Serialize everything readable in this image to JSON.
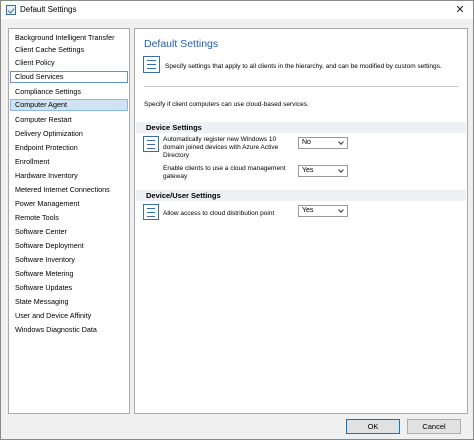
{
  "window": {
    "title": "Default Settings",
    "close_glyph": "✕"
  },
  "sidebar": {
    "items": [
      {
        "label": "Background Intelligent Transfer"
      },
      {
        "label": "Client Cache Settings"
      },
      {
        "label": "Client Policy"
      },
      {
        "label": "Cloud Services"
      },
      {
        "label": "Compliance Settings"
      },
      {
        "label": "Computer Agent"
      },
      {
        "label": "Computer Restart"
      },
      {
        "label": "Delivery Optimization"
      },
      {
        "label": "Endpoint Protection"
      },
      {
        "label": "Enrollment"
      },
      {
        "label": "Hardware Inventory"
      },
      {
        "label": "Metered Internet Connections"
      },
      {
        "label": "Power Management"
      },
      {
        "label": "Remote Tools"
      },
      {
        "label": "Software Center"
      },
      {
        "label": "Software Deployment"
      },
      {
        "label": "Software Inventory"
      },
      {
        "label": "Software Metering"
      },
      {
        "label": "Software Updates"
      },
      {
        "label": "State Messaging"
      },
      {
        "label": "User and Device Affinity"
      },
      {
        "label": "Windows Diagnostic Data"
      }
    ],
    "outlined_item": "Cloud Services",
    "selected_item": "Computer Agent"
  },
  "main": {
    "title": "Default Settings",
    "description": "Specify settings that apply to all clients in the hierarchy, and can be modified by custom settings.",
    "intro": "Specify if client computers can use cloud-based services.",
    "sections": [
      {
        "header": "Device Settings",
        "settings": [
          {
            "label": "Automatically register new Windows 10 domain joined devices with Azure Active Directory",
            "value": "No"
          },
          {
            "label": "Enable clients to use a cloud management gateway",
            "value": "Yes"
          }
        ]
      },
      {
        "header": "Device/User Settings",
        "settings": [
          {
            "label": "Allow access to cloud distribution point",
            "value": "Yes"
          }
        ]
      }
    ]
  },
  "footer": {
    "ok_label": "OK",
    "cancel_label": "Cancel"
  },
  "colors": {
    "accent": "#1e5fb4",
    "selection": "#cce4f7",
    "section_bg": "#eef0f4"
  }
}
